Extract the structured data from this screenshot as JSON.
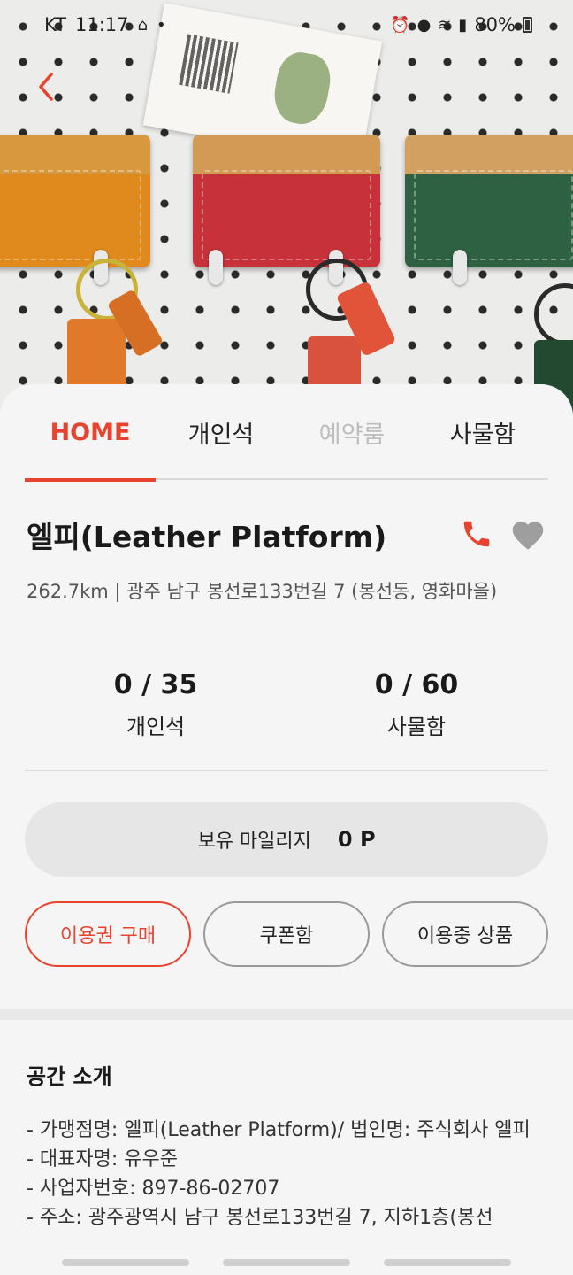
{
  "status_bar": {
    "carrier": "KT",
    "time": "11:17",
    "battery": "80%"
  },
  "tabs": [
    {
      "label": "HOME",
      "state": "active"
    },
    {
      "label": "개인석",
      "state": "normal"
    },
    {
      "label": "예약룸",
      "state": "disabled"
    },
    {
      "label": "사물함",
      "state": "normal"
    }
  ],
  "store": {
    "name": "엘피(Leather Platform)",
    "address": "262.7km | 광주 남구 봉선로133번길 7 (봉선동, 영화마을)"
  },
  "stats": [
    {
      "value": "0 / 35",
      "label": "개인석"
    },
    {
      "value": "0 / 60",
      "label": "사물함"
    }
  ],
  "mileage": {
    "label": "보유 마일리지",
    "value": "0 P"
  },
  "actions": {
    "buy": "이용권 구매",
    "coupon": "쿠폰함",
    "in_use": "이용중 상품"
  },
  "intro": {
    "title": "공간 소개",
    "lines": [
      "- 가맹점명: 엘피(Leather Platform)/ 법인명: 주식회사 엘피",
      "- 대표자명: 유우준",
      "- 사업자번호: 897-86-02707",
      "- 주소: 광주광역시 남구 봉선로133번길 7, 지하1층(봉선"
    ]
  },
  "colors": {
    "accent": "#e8432f",
    "heart": "#9e9e9e"
  },
  "icons": {
    "back": "chevron-left-icon",
    "phone": "phone-icon",
    "favorite": "heart-icon"
  }
}
